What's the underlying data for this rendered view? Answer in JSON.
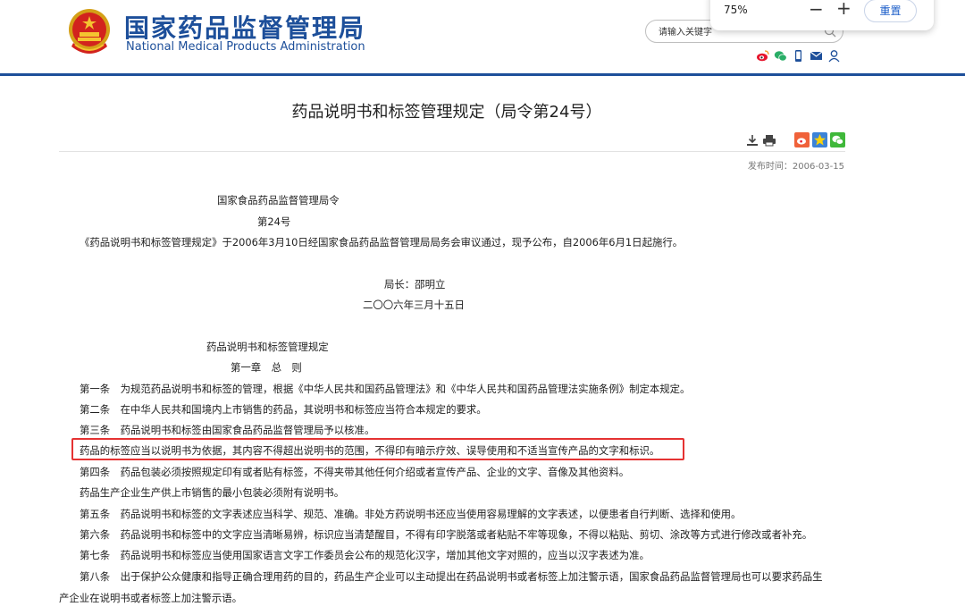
{
  "header": {
    "site_title_cn": "国家药品监督管理局",
    "site_title_en": "National Medical Products Administration",
    "search_placeholder": "请输入关键字",
    "brand_color": "#1d4f9a"
  },
  "zoom_popup": {
    "value": "75%",
    "minus": "−",
    "plus": "+",
    "reset_label": "重置"
  },
  "social_icons": [
    "weibo-icon",
    "wechat-icon",
    "mobile-icon",
    "email-icon",
    "user-icon"
  ],
  "article": {
    "title": "药品说明书和标签管理规定（局令第24号）",
    "publish_date": "发布时间：2006-03-15",
    "tools": [
      "download-icon",
      "print-icon",
      "share-weibo-icon",
      "share-qzone-icon",
      "share-wechat-icon"
    ],
    "lines": [
      "国家食品药品监督管理局令",
      "第24号",
      "《药品说明书和标签管理规定》于2006年3月10日经国家食品药品监督管理局局务会审议通过，现予公布，自2006年6月1日起施行。",
      "局长：邵明立",
      "二〇〇六年三月十五日",
      "药品说明书和标签管理规定",
      "第一章　总　则",
      "第一条　为规范药品说明书和标签的管理，根据《中华人民共和国药品管理法》和《中华人民共和国药品管理法实施条例》制定本规定。",
      "第二条　在中华人民共和国境内上市销售的药品，其说明书和标签应当符合本规定的要求。",
      "第三条　药品说明书和标签由国家食品药品监督管理局予以核准。",
      "药品的标签应当以说明书为依据，其内容不得超出说明书的范围，不得印有暗示疗效、误导使用和不适当宣传产品的文字和标识。",
      "第四条　药品包装必须按照规定印有或者贴有标签，不得夹带其他任何介绍或者宣传产品、企业的文字、音像及其他资料。",
      "药品生产企业生产供上市销售的最小包装必须附有说明书。",
      "第五条　药品说明书和标签的文字表述应当科学、规范、准确。非处方药说明书还应当使用容易理解的文字表述，以便患者自行判断、选择和使用。",
      "第六条　药品说明书和标签中的文字应当清晰易辨，标识应当清楚醒目，不得有印字脱落或者粘贴不牢等现象，不得以粘贴、剪切、涂改等方式进行修改或者补充。",
      "第七条　药品说明书和标签应当使用国家语言文字工作委员会公布的规范化汉字，增加其他文字对照的，应当以汉字表述为准。",
      "第八条　出于保护公众健康和指导正确合理用药的目的，药品生产企业可以主动提出在药品说明书或者标签上加注警示语，国家食品药品监督管理局也可以要求药品生",
      "产企业在说明书或者标签上加注警示语。"
    ],
    "highlight_color": "#e53232"
  }
}
